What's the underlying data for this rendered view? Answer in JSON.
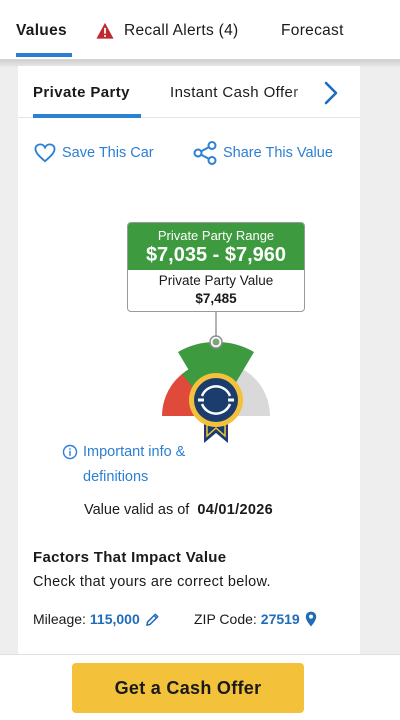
{
  "top_tabs": [
    {
      "label": "Values",
      "active": true
    },
    {
      "label": "Recall Alerts (4)",
      "active": false
    },
    {
      "label": "Forecast",
      "active": false
    }
  ],
  "sub_tabs": [
    {
      "label": "Private Party",
      "active": true
    },
    {
      "label": "Instant Cash Offer",
      "active": false
    }
  ],
  "actions": {
    "save_label": "Save This Car",
    "share_label": "Share This Value"
  },
  "value_box": {
    "range_label": "Private Party Range",
    "range_value": "$7,035 - $7,960",
    "value_label": "Private Party Value",
    "value": "$7,485"
  },
  "info": {
    "link_text": "Important info & definitions"
  },
  "valid": {
    "prefix": "Value valid as of",
    "date": "04/01/2026"
  },
  "factors": {
    "title": "Factors That Impact Value",
    "subtitle": "Check that yours are correct below.",
    "mileage_label": "Mileage:",
    "mileage_value": "115,000",
    "zip_label": "ZIP Code:",
    "zip_value": "27519"
  },
  "cta": {
    "label": "Get a Cash Offer"
  },
  "colors": {
    "accent_blue": "#2b7fd4",
    "range_green": "#3d9a3f",
    "gauge_red": "#e04a3a",
    "gauge_gray": "#d9d9d9",
    "cta_yellow": "#f4c13b",
    "warning_red": "#c0282d"
  },
  "icons": [
    "warning-icon",
    "chevron-right-icon",
    "heart-icon",
    "share-icon",
    "info-icon",
    "pencil-icon",
    "location-pin-icon",
    "ribbon-badge-icon"
  ]
}
